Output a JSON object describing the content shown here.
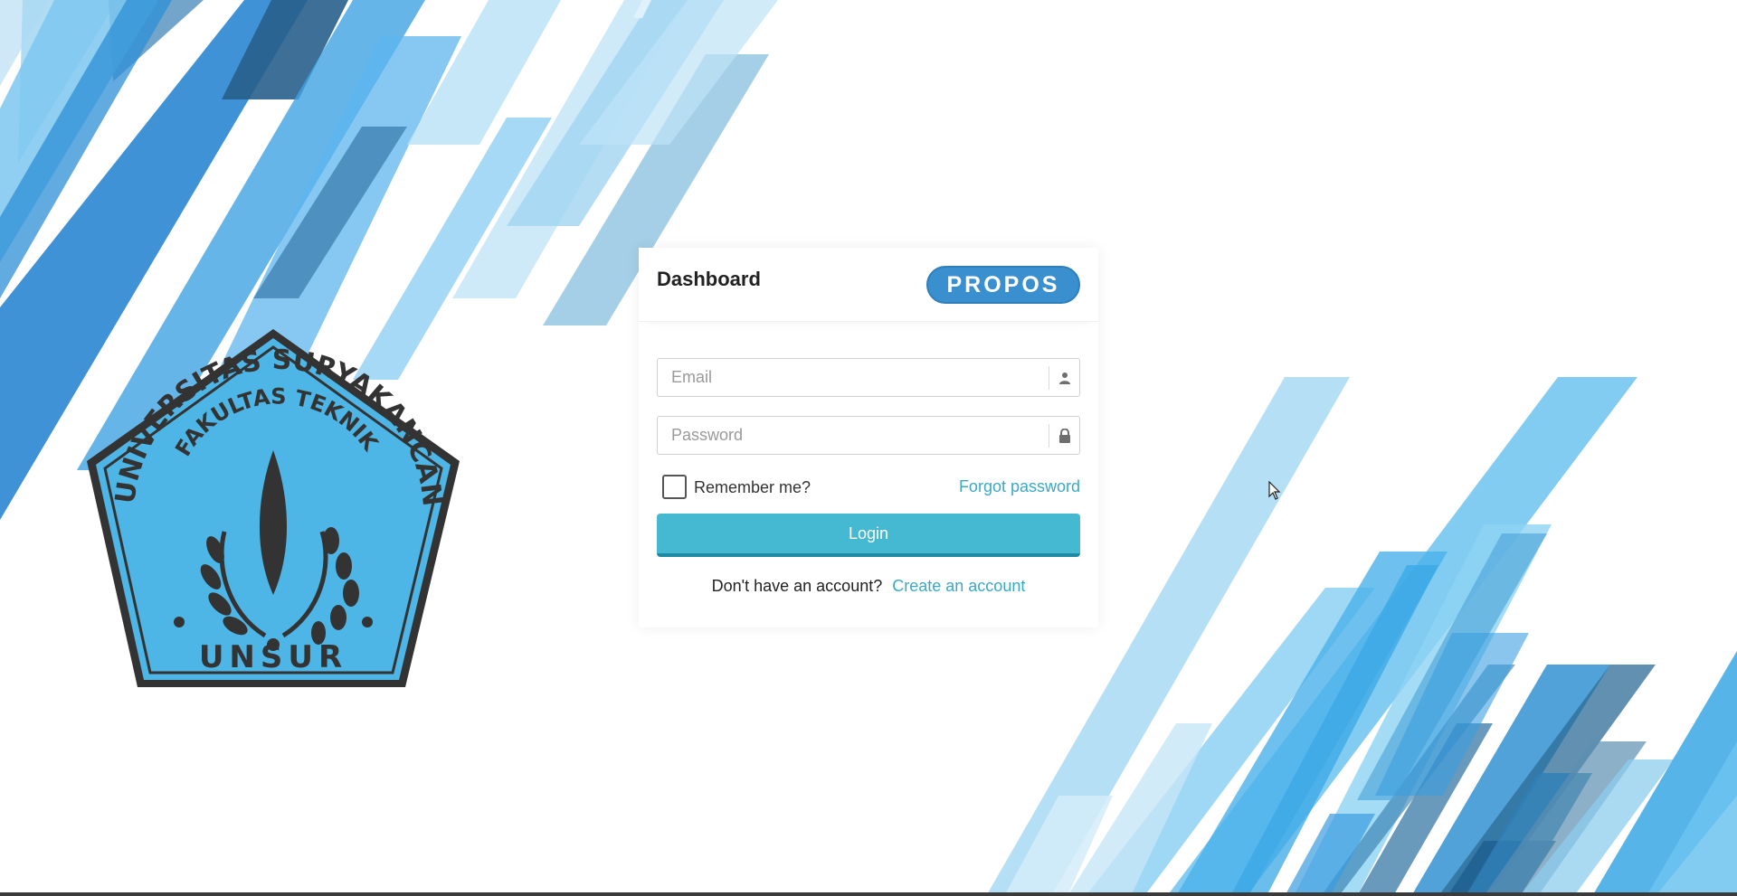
{
  "login_card": {
    "title": "Dashboard",
    "brand": "PROPOS",
    "email_placeholder": "Email",
    "password_placeholder": "Password",
    "remember_label": "Remember me?",
    "remember_checked": false,
    "forgot_password": "Forgot password",
    "login_button": "Login",
    "no_account_text": "Don't have an account?",
    "create_account": "Create an account"
  },
  "emblem": {
    "arc_outer": "UNIVERSITAS SURYAKANCANA",
    "arc_inner": "FAKULTAS TEKNIK",
    "bottom": "UNSUR"
  },
  "icons": {
    "email_field": "user-icon",
    "password_field": "lock-icon"
  },
  "colors": {
    "accent": "#45b8d2",
    "link": "#3aa9c6",
    "brand": "#3a8fce",
    "emblem_fill": "#4db6e6",
    "emblem_ink": "#333333"
  }
}
